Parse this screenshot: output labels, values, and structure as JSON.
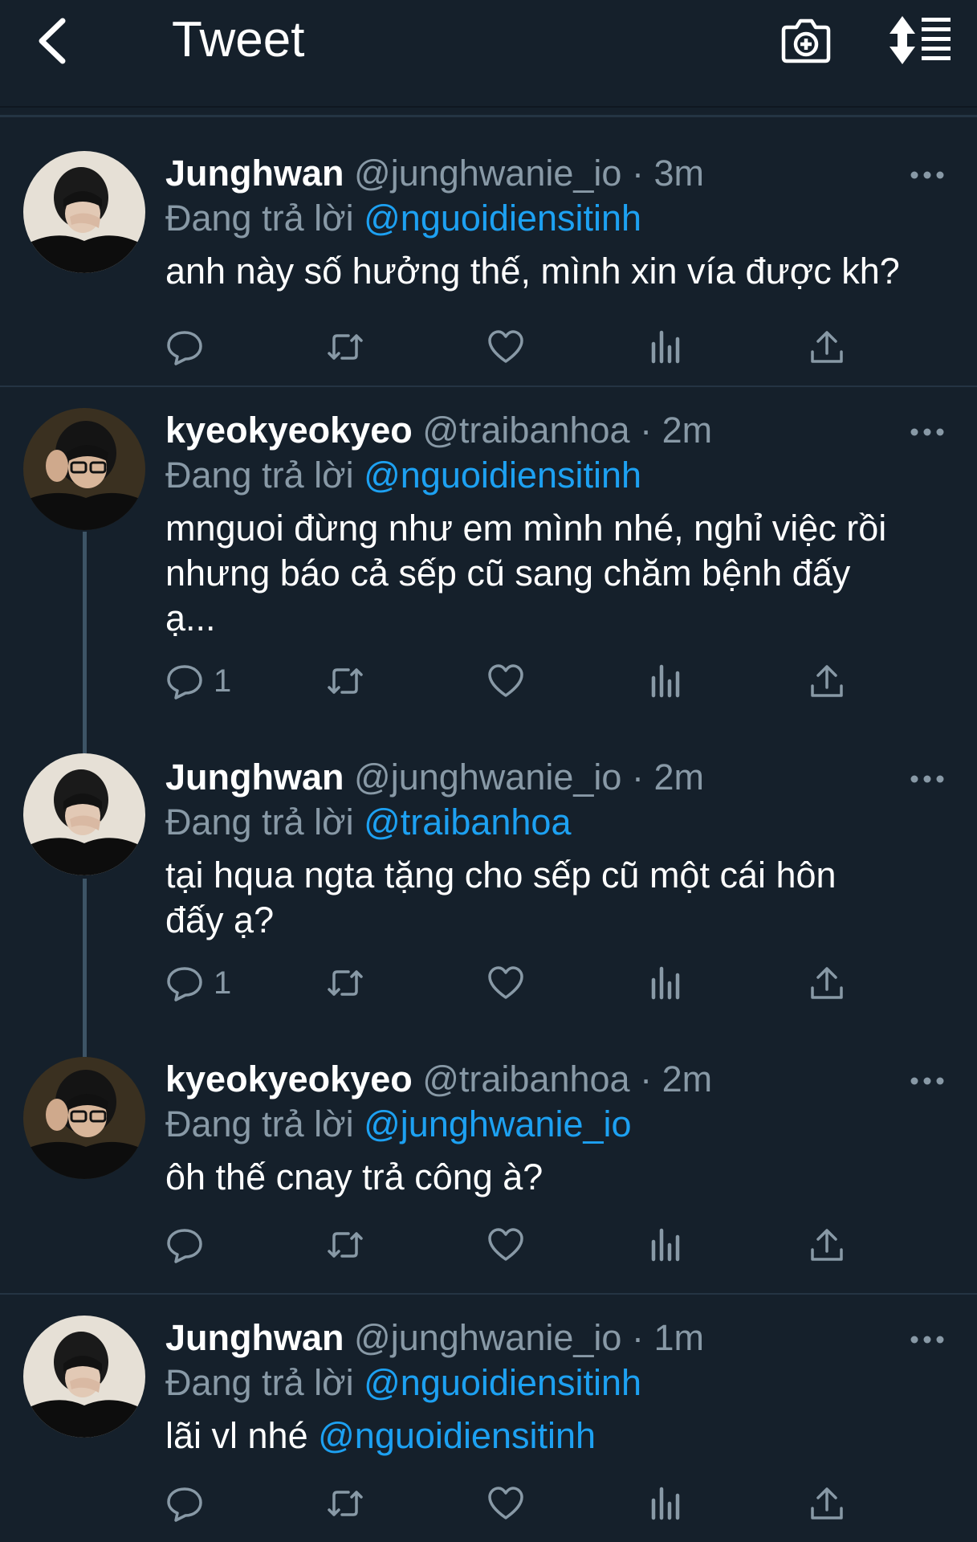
{
  "header": {
    "title": "Tweet"
  },
  "tweets": [
    {
      "name": "Junghwan",
      "handle": "@junghwanie_io",
      "dot": "·",
      "time": "3m",
      "reply_prefix": "Đang trả lời",
      "reply_to": "@nguoidiensitinh",
      "text": "anh này số hưởng thế, mình xin vía được kh?",
      "replies": ""
    },
    {
      "name": "kyeokyeokyeo",
      "handle": "@traibanhoa",
      "dot": "·",
      "time": "2m",
      "reply_prefix": "Đang trả lời",
      "reply_to": "@nguoidiensitinh",
      "text_lines": [
        "mnguoi đừng như em mình nhé, nghỉ việc rồi",
        "nhưng báo cả sếp cũ sang chăm bệnh đấy",
        "ạ..."
      ],
      "replies": "1"
    },
    {
      "name": "Junghwan",
      "handle": "@junghwanie_io",
      "dot": "·",
      "time": "2m",
      "reply_prefix": "Đang trả lời",
      "reply_to": "@traibanhoa",
      "text_lines": [
        "tại hqua ngta tặng cho sếp cũ một cái hôn",
        "đấy ạ?"
      ],
      "replies": "1"
    },
    {
      "name": "kyeokyeokyeo",
      "handle": "@traibanhoa",
      "dot": "·",
      "time": "2m",
      "reply_prefix": "Đang trả lời",
      "reply_to": "@junghwanie_io",
      "text": "ôh thế cnay trả công à?",
      "replies": ""
    },
    {
      "name": "Junghwan",
      "handle": "@junghwanie_io",
      "dot": "·",
      "time": "1m",
      "reply_prefix": "Đang trả lời",
      "reply_to": "@nguoidiensitinh",
      "text_prefix": "lãi vl nhé",
      "text_mention": "@nguoidiensitinh",
      "replies": ""
    }
  ],
  "icons": {
    "back": "chevron-left-icon",
    "camera": "camera-plus-icon",
    "sort": "sort-list-icon",
    "more": "more-dots-icon",
    "reply": "reply-icon",
    "retweet": "retweet-icon",
    "like": "heart-icon",
    "analytics": "analytics-icon",
    "share": "share-icon"
  },
  "colors": {
    "background": "#15202b",
    "accent": "#1da1f2",
    "secondary_text": "#8899a6",
    "divider": "#243443",
    "thread_line": "#3d5466"
  }
}
